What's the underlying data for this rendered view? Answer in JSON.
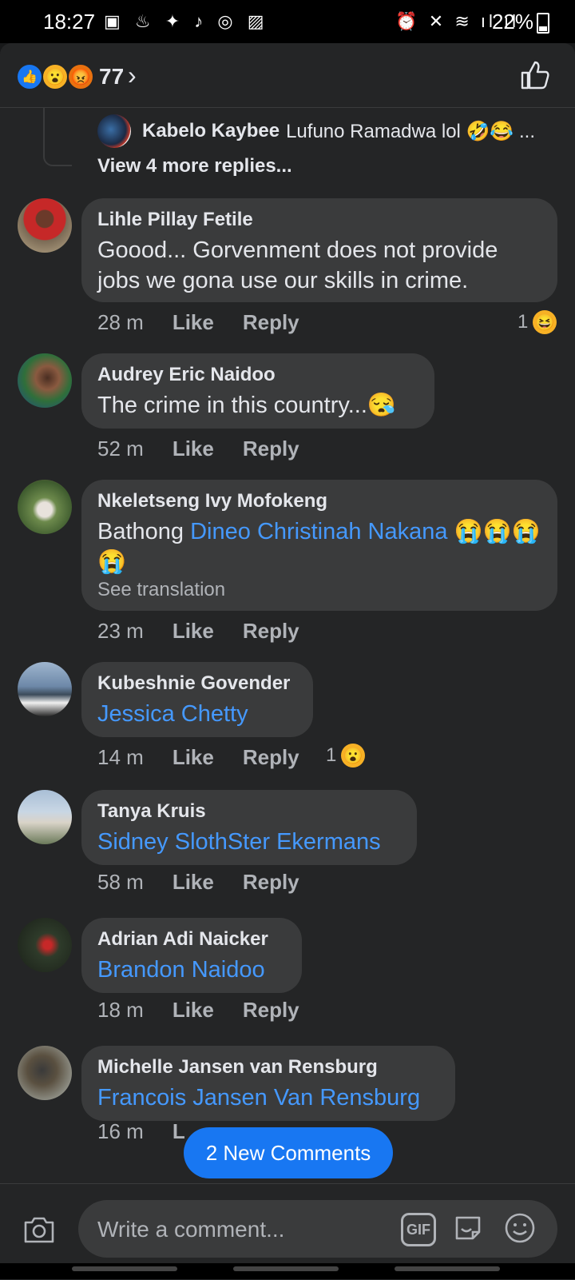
{
  "status_bar": {
    "time": "18:27",
    "left_icons": "▣ ♨ ✦ ♪ ◎ ▨",
    "right_icons": "⏰ ✕ ≋ ıl ıl",
    "battery": "22%"
  },
  "reactions": {
    "count": "77",
    "icons": [
      "like-icon",
      "wow-icon",
      "angry-icon"
    ]
  },
  "reply_preview": {
    "name": "Kabelo Kaybee",
    "text": "Lufuno Ramadwa lol 🤣😂 ...",
    "view_more": "View 4 more replies..."
  },
  "comments": [
    {
      "name": "Lihle Pillay Fetile",
      "text": "Goood... Gorvenment does not provide jobs we gona use our skills in crime.",
      "time": "28 m",
      "like": "Like",
      "reply": "Reply",
      "reaction_count": "1",
      "reaction_emoji": "😆"
    },
    {
      "name": "Audrey Eric Naidoo",
      "text": "The crime in this country...😪",
      "time": "52 m",
      "like": "Like",
      "reply": "Reply"
    },
    {
      "name": "Nkeletseng Ivy Mofokeng",
      "text_prefix": "Bathong",
      "mention": "Dineo Christinah Nakana",
      "text_suffix": "😭😭😭😭",
      "see_translation": "See translation",
      "time": "23 m",
      "like": "Like",
      "reply": "Reply"
    },
    {
      "name": "Kubeshnie Govender",
      "mention": "Jessica Chetty",
      "time": "14 m",
      "like": "Like",
      "reply": "Reply",
      "reaction_count": "1",
      "reaction_emoji": "😮"
    },
    {
      "name": "Tanya Kruis",
      "mention": "Sidney SlothSter Ekermans",
      "time": "58 m",
      "like": "Like",
      "reply": "Reply"
    },
    {
      "name": "Adrian Adi Naicker",
      "mention": "Brandon Naidoo",
      "time": "18 m",
      "like": "Like",
      "reply": "Reply"
    },
    {
      "name": "Michelle Jansen van Rensburg",
      "mention": "Francois Jansen Van Rensburg",
      "time": "16 m",
      "like": "L"
    }
  ],
  "new_comments_button": "2 New Comments",
  "composer": {
    "placeholder": "Write a comment...",
    "gif_label": "GIF"
  },
  "colors": {
    "background": "#18191a",
    "sheet": "#242526",
    "bubble": "#3a3b3c",
    "link": "#4599ff",
    "accent": "#1877f2"
  }
}
